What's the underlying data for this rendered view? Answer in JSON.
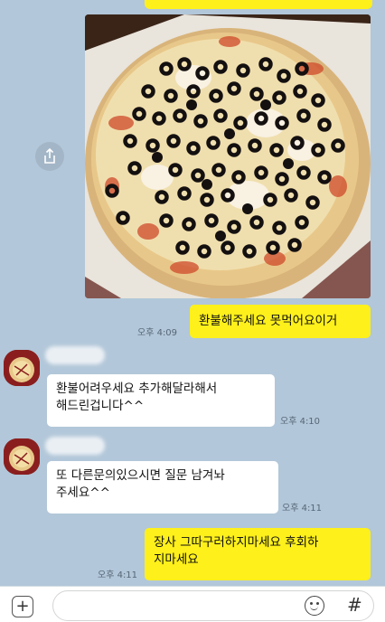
{
  "theme": {
    "background": "#b2c7d9",
    "my_bubble": "#fef01b",
    "other_bubble": "#ffffff"
  },
  "messages": [
    {
      "sender": "me",
      "type": "image",
      "content": "pizza-photo"
    },
    {
      "sender": "me",
      "text": "환불해주세요 못먹어요이거",
      "time": "오후 4:09"
    },
    {
      "sender": "other",
      "lines": [
        "환불어려우세요 추가해달라해서",
        "해드린겁니다^^"
      ],
      "time": "오후 4:10"
    },
    {
      "sender": "other",
      "lines": [
        "또 다른문의있으시면 질문 남겨놔",
        "주세요^^"
      ],
      "time": "오후 4:11"
    },
    {
      "sender": "me",
      "lines": [
        "장사 그따구러하지마세요 후회하",
        "지마세요"
      ],
      "time": "오후 4:11"
    }
  ],
  "icons": {
    "share": "share-icon",
    "attach": "plus-icon",
    "emoticon": "emoticon-icon",
    "hashtag": "hashtag-icon"
  },
  "input": {
    "hashtag_glyph": "#",
    "plus_glyph": "+"
  }
}
